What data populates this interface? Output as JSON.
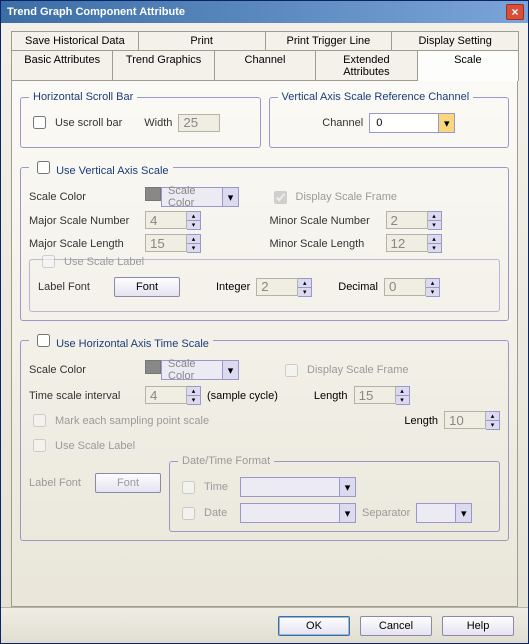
{
  "window": {
    "title": "Trend Graph Component Attribute"
  },
  "tabs_row1": [
    {
      "label": "Save Historical Data"
    },
    {
      "label": "Print"
    },
    {
      "label": "Print Trigger Line"
    },
    {
      "label": "Display Setting"
    }
  ],
  "tabs_row2": [
    {
      "label": "Basic Attributes"
    },
    {
      "label": "Trend Graphics"
    },
    {
      "label": "Channel"
    },
    {
      "label": "Extended Attributes"
    },
    {
      "label": "Scale"
    }
  ],
  "hscroll": {
    "legend": "Horizontal Scroll Bar",
    "use_label": "Use scroll bar",
    "width_label": "Width",
    "width_value": "25"
  },
  "vaxis_channel": {
    "legend": "Vertical Axis Scale Reference Channel",
    "channel_label": "Channel",
    "channel_value": "0"
  },
  "vaxis": {
    "use_label": "Use Vertical Axis Scale",
    "scale_color_label": "Scale Color",
    "scale_color_value": "Scale Color",
    "display_scale_frame": "Display Scale Frame",
    "major_num_label": "Major Scale Number",
    "major_num_value": "4",
    "minor_num_label": "Minor Scale Number",
    "minor_num_value": "2",
    "major_len_label": "Major Scale Length",
    "major_len_value": "15",
    "minor_len_label": "Minor Scale Length",
    "minor_len_value": "12",
    "use_scale_label": "Use Scale Label",
    "label_font": "Label Font",
    "font_btn": "Font",
    "integer_label": "Integer",
    "integer_value": "2",
    "decimal_label": "Decimal",
    "decimal_value": "0"
  },
  "haxis": {
    "use_label": "Use Horizontal Axis Time Scale",
    "scale_color_label": "Scale Color",
    "scale_color_value": "Scale Color",
    "display_scale_frame": "Display Scale Frame",
    "time_interval_label": "Time scale interval",
    "time_interval_value": "4",
    "sample_cycle": "(sample cycle)",
    "length_label": "Length",
    "length_value_a": "15",
    "mark_each": "Mark each sampling point scale",
    "length_value_b": "10",
    "use_scale_label": "Use Scale Label",
    "label_font": "Label Font",
    "font_btn": "Font",
    "dt_legend": "Date/Time Format",
    "time_label": "Time",
    "date_label": "Date",
    "separator_label": "Separator"
  },
  "footer": {
    "ok": "OK",
    "cancel": "Cancel",
    "help": "Help"
  }
}
